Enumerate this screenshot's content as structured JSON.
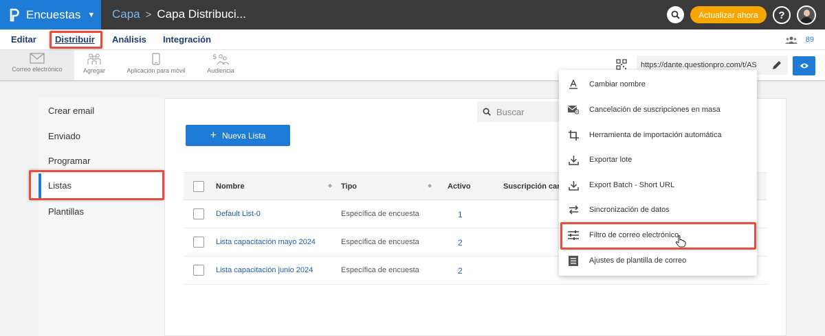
{
  "app": {
    "brand": "Encuestas",
    "breadcrumb": [
      "Capa",
      "Capa Distribuci..."
    ]
  },
  "topbar": {
    "upgrade_label": "Actualizar ahora",
    "help_label": "?"
  },
  "menu": {
    "items": [
      "Editar",
      "Distribuir",
      "Análisis",
      "Integración"
    ],
    "active": "Distribuir",
    "users_count": "89"
  },
  "toolbar": {
    "tools": [
      "Correo electrónico",
      "Agregar",
      "Aplicación para móvil",
      "Audiencia"
    ],
    "survey_url": "https://dante.questionpro.com/t/AS"
  },
  "sidenav": {
    "items": [
      "Crear email",
      "Enviado",
      "Programar",
      "Listas",
      "Plantillas"
    ],
    "active": "Listas"
  },
  "main": {
    "search_placeholder": "Buscar",
    "new_list_label": "Nueva Lista",
    "table": {
      "headers": [
        "Nombre",
        "Tipo",
        "Activo",
        "Suscripción canc"
      ],
      "rows": [
        {
          "name": "Default List-0",
          "type": "Específica de encuesta",
          "active": "1"
        },
        {
          "name": "Lista capacitación mayo 2024",
          "type": "Específica de encuesta",
          "active": "2"
        },
        {
          "name": "Lista capacitación junio 2024",
          "type": "Específica de encuesta",
          "active": "2"
        }
      ]
    }
  },
  "dropdown": {
    "items": [
      {
        "label": "Cambiar nombre",
        "icon": "rename-icon"
      },
      {
        "label": "Cancelación de suscripciones en masa",
        "icon": "mail-unsubscribe-icon"
      },
      {
        "label": "Herramienta de importación automática",
        "icon": "crop-import-icon"
      },
      {
        "label": "Exportar lote",
        "icon": "download-icon"
      },
      {
        "label": "Export Batch - Short URL",
        "icon": "download-icon"
      },
      {
        "label": "Sincronización de datos",
        "icon": "sync-arrows-icon"
      },
      {
        "label": "Filtro de correo electrónico",
        "icon": "filter-sliders-icon"
      },
      {
        "label": "Ajustes de plantilla de correo",
        "icon": "template-list-icon"
      }
    ]
  },
  "colors": {
    "brand_blue": "#1e7cd6",
    "topbar": "#3a3a3a",
    "upgrade": "#f7a600",
    "highlight": "#e84c3d"
  }
}
